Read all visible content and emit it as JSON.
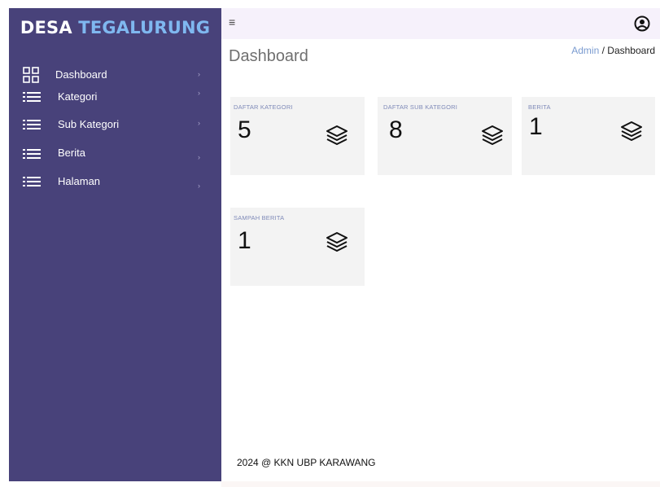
{
  "sidebar": {
    "brand_part1": "DESA",
    "brand_part2": "TEGALURUNG",
    "items": [
      {
        "label": "Dashboard",
        "icon": "grid-icon"
      },
      {
        "label": "Kategori",
        "icon": "list-icon"
      },
      {
        "label": "Sub Kategori",
        "icon": "list-icon"
      },
      {
        "label": "Berita",
        "icon": "list-icon"
      },
      {
        "label": "Halaman",
        "icon": "list-icon"
      }
    ],
    "chevron": "›"
  },
  "topbar": {
    "menu_glyph": "≡",
    "user_icon": "user-circle-icon"
  },
  "page": {
    "title": "Dashboard",
    "breadcrumb_link": "Admin",
    "breadcrumb_sep": " / ",
    "breadcrumb_current": "Dashboard"
  },
  "cards": [
    {
      "label": "DAFTAR KATEGORI",
      "value": "5",
      "icon": "layers-icon"
    },
    {
      "label": "DAFTAR SUB KATEGORI",
      "value": "8",
      "icon": "layers-icon"
    },
    {
      "label": "BERITA",
      "value": "1",
      "icon": "layers-icon"
    },
    {
      "label": "SAMPAH BERITA",
      "value": "1",
      "icon": "layers-icon"
    }
  ],
  "footer": {
    "text": "2024 @ KKN UBP KARAWANG"
  },
  "colors": {
    "sidebar_bg": "#48427a",
    "brand_accent": "#7fb8f0",
    "topbar_bg": "#f6f1fb",
    "card_bg": "#f3f3f3",
    "card_label": "#7f8ab8",
    "breadcrumb_link": "#7a9bd0"
  }
}
